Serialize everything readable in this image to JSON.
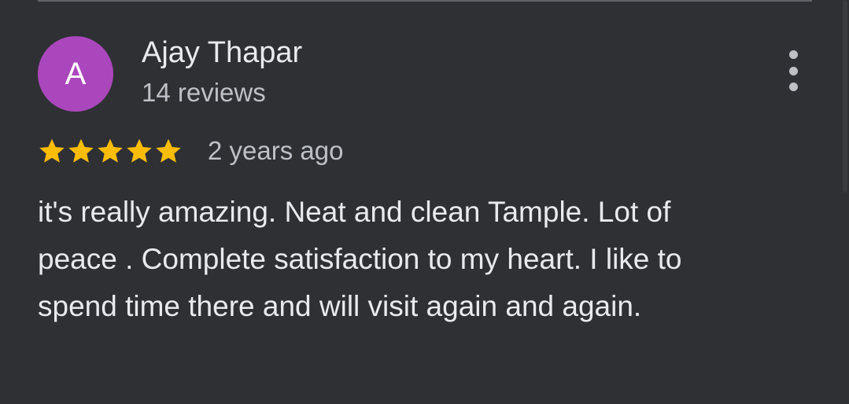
{
  "review": {
    "avatar_initial": "A",
    "avatar_color": "#ab47bc",
    "reviewer_name": "Ajay Thapar",
    "review_count": "14 reviews",
    "rating": 5,
    "rating_max": 5,
    "star_color": "#fbbc04",
    "time_ago": "2 years ago",
    "text": "it's really amazing. Neat and clean Tample. Lot of peace . Complete satisfaction to my heart. I like to spend time there and will visit again and again.",
    "more_icon": "more-vert-icon"
  }
}
